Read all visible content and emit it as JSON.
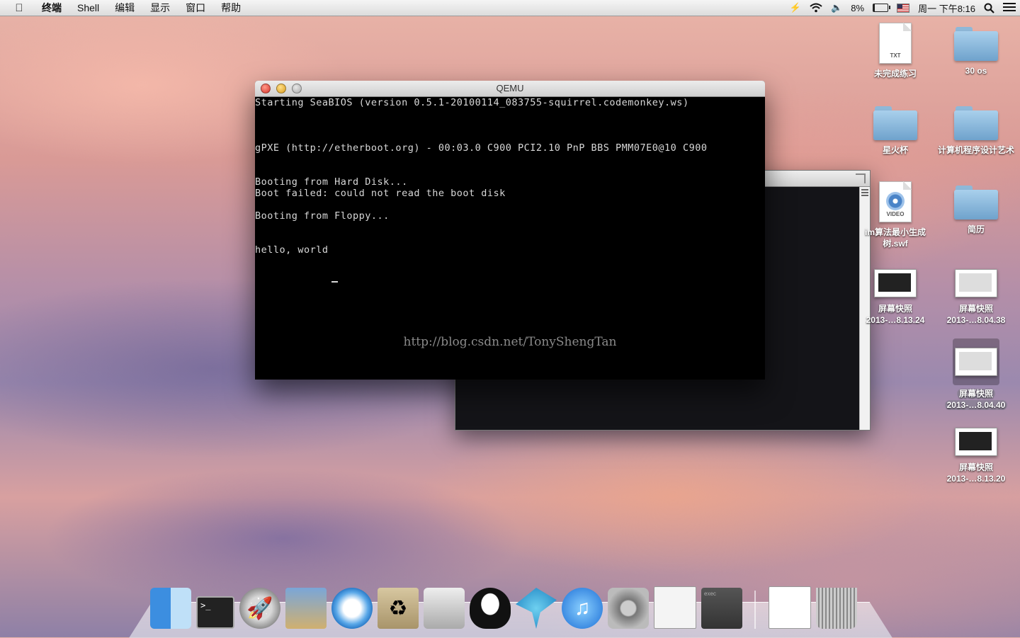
{
  "menubar": {
    "app_name": "终端",
    "menus": [
      "Shell",
      "编辑",
      "显示",
      "窗口",
      "帮助"
    ],
    "battery_percent": "8%",
    "battery_level": 0.08,
    "clock": "周一 下午8:16"
  },
  "qemu_window": {
    "title": "QEMU",
    "lines": [
      "Starting SeaBIOS (version 0.5.1-20100114_083755-squirrel.codemonkey.ws)",
      "gPXE (http://etherboot.org) - 00:03.0 C900 PCI2.10 PnP BBS PMM07E0@10 C900",
      "Booting from Hard Disk...",
      "Boot failed: could not read the boot disk",
      "Booting from Floppy...",
      "hello, world"
    ],
    "watermark": "http://blog.csdn.net/TonyShengTan"
  },
  "desktop_icons": [
    {
      "label": "未完成练习",
      "type": "txt",
      "tag": "TXT"
    },
    {
      "label": "30 os",
      "type": "folder"
    },
    {
      "label": "星火杯",
      "type": "folder"
    },
    {
      "label": "计算机程序设计艺术",
      "type": "folder"
    },
    {
      "label": "im算法最小生成树.swf",
      "type": "video",
      "tag": "VIDEO"
    },
    {
      "label": "简历",
      "type": "folder"
    },
    {
      "label": "屏幕快照",
      "sub": "2013-…8.13.24",
      "type": "screenshot"
    },
    {
      "label": "屏幕快照",
      "sub": "2013-…8.04.38",
      "type": "screenshot"
    },
    {
      "label": "屏幕快照",
      "sub": "2013-…8.04.40",
      "type": "screenshot"
    },
    {
      "label": "屏幕快照",
      "sub": "2013-…8.13.20",
      "type": "screenshot"
    }
  ],
  "dock": {
    "terminal_prompt": ">_",
    "exec_label": "exec"
  }
}
